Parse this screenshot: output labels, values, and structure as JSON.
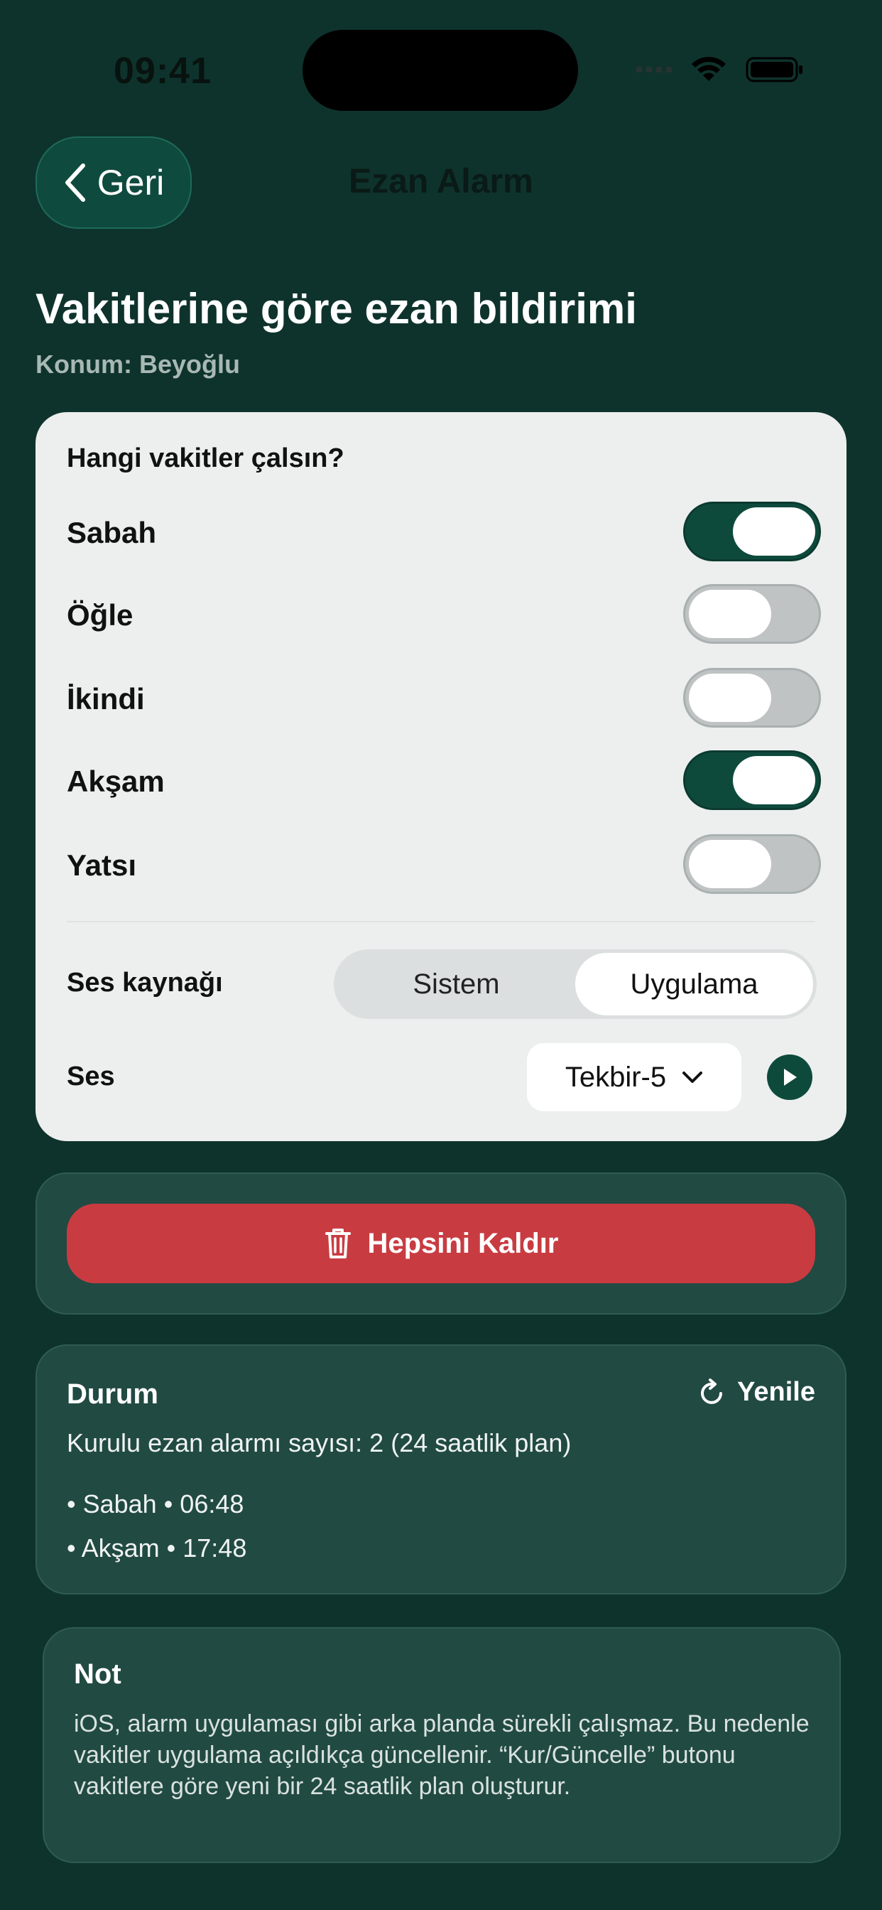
{
  "status_bar": {
    "time": "09:41"
  },
  "nav": {
    "back_label": "Geri",
    "title": "Ezan Alarm"
  },
  "header": {
    "title": "Vakitlerine göre ezan bildirimi",
    "location": "Konum: Beyoğlu"
  },
  "settings": {
    "heading": "Hangi vakitler çalsın?",
    "prayers": [
      {
        "label": "Sabah",
        "on": true
      },
      {
        "label": "Öğle",
        "on": false
      },
      {
        "label": "İkindi",
        "on": false
      },
      {
        "label": "Akşam",
        "on": true
      },
      {
        "label": "Yatsı",
        "on": false
      }
    ],
    "source_label": "Ses kaynağı",
    "source_options": [
      "Sistem",
      "Uygulama"
    ],
    "source_selected": "Uygulama",
    "sound_label": "Ses",
    "sound_value": "Tekbir-5"
  },
  "actions": {
    "remove_all": "Hepsini Kaldır"
  },
  "status": {
    "title": "Durum",
    "refresh": "Yenile",
    "count_text": "Kurulu ezan alarmı sayısı: 2 (24 saatlik plan)",
    "items": [
      "• Sabah • 06:48",
      "• Akşam • 17:48"
    ]
  },
  "note": {
    "title": "Not",
    "text": "iOS, alarm uygulaması gibi arka planda sürekli çalışmaz. Bu nedenle vakitler uygulama açıldıkça güncellenir. “Kur/Güncelle” butonu vakitlere göre yeni bir 24 saatlik plan oluşturur."
  },
  "colors": {
    "background": "#0e332c",
    "accent": "#0e4a3c",
    "danger": "#c83c41",
    "card": "#ecefee"
  }
}
